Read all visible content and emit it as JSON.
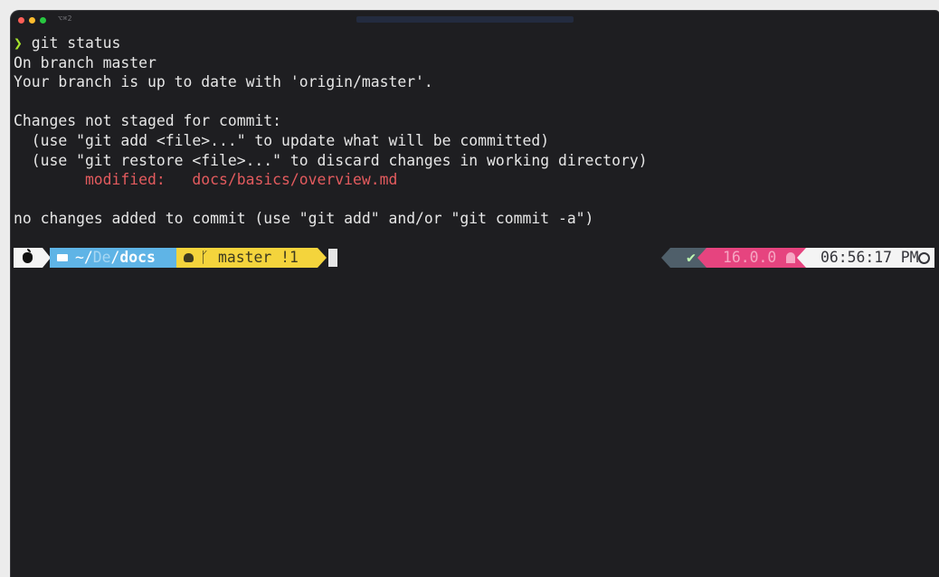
{
  "window": {
    "tab_hint": "⌥⌘2"
  },
  "terminal": {
    "lines": [
      {
        "kind": "command",
        "prompt": "❯",
        "text": " git status"
      },
      {
        "kind": "text",
        "text": "On branch master"
      },
      {
        "kind": "text",
        "text": "Your branch is up to date with 'origin/master'."
      },
      {
        "kind": "blank",
        "text": ""
      },
      {
        "kind": "text",
        "text": "Changes not staged for commit:"
      },
      {
        "kind": "text",
        "text": "  (use \"git add <file>...\" to update what will be committed)"
      },
      {
        "kind": "text",
        "text": "  (use \"git restore <file>...\" to discard changes in working directory)"
      },
      {
        "kind": "modified",
        "label": "        modified:   ",
        "path": "docs/basics/overview.md"
      },
      {
        "kind": "blank",
        "text": ""
      },
      {
        "kind": "text",
        "text": "no changes added to commit (use \"git add\" and/or \"git commit -a\")"
      }
    ]
  },
  "prompt_bar": {
    "left": {
      "os_icon": "apple-icon",
      "dir_prefix": "~/",
      "dir_dim": "De",
      "dir_sep": "/",
      "dir_current": "docs",
      "folder_icon": "folder-icon",
      "git_icon": "github-octocat-icon",
      "branch_icon": "git-branch-icon",
      "branch": "master",
      "changes": "!1"
    },
    "right": {
      "status_mark": "✔",
      "node_version": "16.0.0",
      "node_icon": "node-icon",
      "time": "06:56:17 PM",
      "clock_icon": "clock-icon"
    }
  },
  "colors": {
    "background": "#1e1e21",
    "prompt_arrow": "#a6e22e",
    "modified": "#e35b5e",
    "dir_segment": "#5fb4e6",
    "git_segment": "#f4d43c",
    "status_segment": "#4f5f6a",
    "node_segment": "#e6447f",
    "time_segment": "#f4f4f4"
  }
}
